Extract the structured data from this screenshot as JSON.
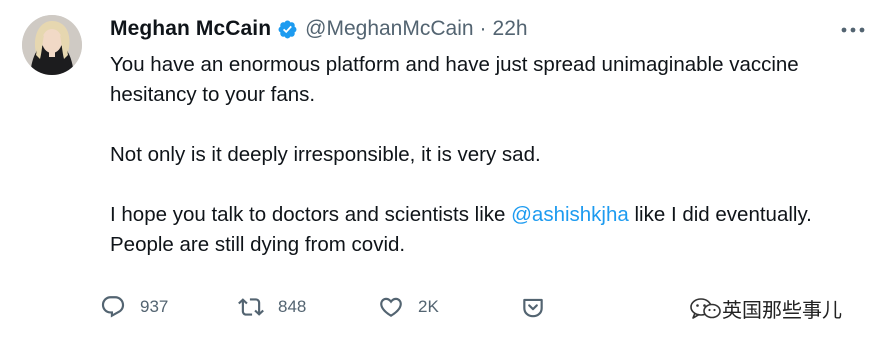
{
  "tweet": {
    "author_name": "Meghan McCain",
    "handle": "@MeghanMcCain",
    "separator": "·",
    "time": "22h",
    "verified": true,
    "paragraphs": [
      {
        "text": "You have an enormous platform and have just spread unimaginable vaccine hesitancy to your fans."
      },
      {
        "text": "Not only is it deeply irresponsible, it is very sad."
      },
      {
        "before": "I hope you talk to doctors and scientists like ",
        "mention": "@ashishkjha",
        "after": " like I did eventually. People are still dying from covid."
      }
    ]
  },
  "actions": {
    "reply": {
      "icon": "reply-icon",
      "count": "937"
    },
    "retweet": {
      "icon": "retweet-icon",
      "count": "848"
    },
    "like": {
      "icon": "heart-icon",
      "count": "2K"
    },
    "share": {
      "icon": "share-icon"
    }
  },
  "watermark": {
    "text": "英国那些事儿"
  },
  "colors": {
    "text": "#0f1419",
    "secondary": "#536471",
    "accent": "#1d9bf0",
    "background": "#ffffff"
  }
}
